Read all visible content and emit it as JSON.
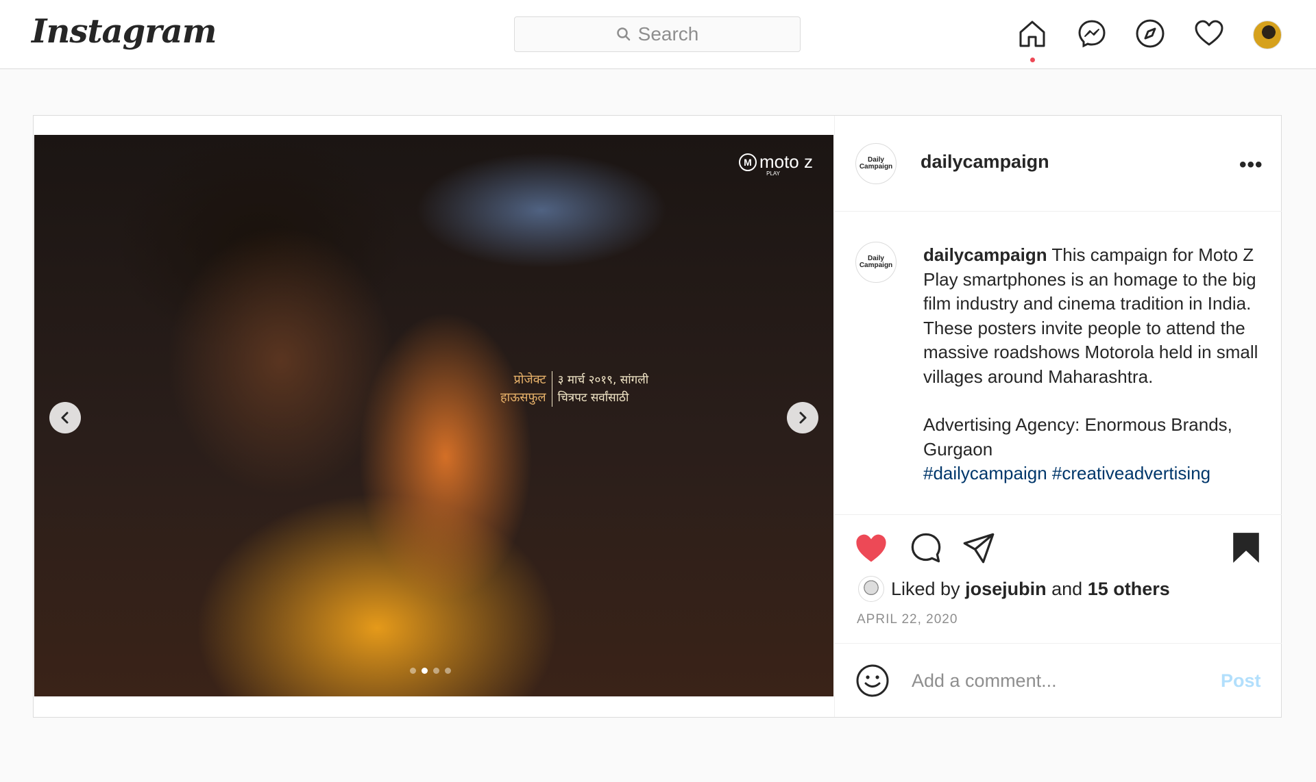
{
  "header": {
    "logo": "Instagram",
    "search_placeholder": "Search",
    "icons": [
      "home-icon",
      "messenger-icon",
      "explore-icon",
      "activity-heart-icon",
      "profile-avatar"
    ]
  },
  "post": {
    "media": {
      "brand": "moto z",
      "brand_sub": "PLAY",
      "poster_left": [
        "प्रोजेक्ट",
        "हाऊसफुल"
      ],
      "poster_right": [
        "३ मार्च २०१९, सांगली",
        "चित्रपट सर्वांसाठी"
      ],
      "carousel_dots": 4,
      "active_dot": 2
    },
    "author": {
      "username": "dailycampaign",
      "avatar_text": "Daily Campaign"
    },
    "caption": {
      "username": "dailycampaign",
      "text": "This campaign for Moto Z Play smartphones is an homage to the big film industry and cinema tradition in India. These posters invite people to attend the massive roadshows Motorola held in small villages around Maharashtra.",
      "agency": "Advertising Agency: Enormous Brands, Gurgaon",
      "hashtags": "#dailycampaign #creativeadvertising"
    },
    "likes": {
      "prefix": "Liked by",
      "user": "josejubin",
      "and": "and",
      "others": "15 others"
    },
    "date": "APRIL 22, 2020",
    "comment": {
      "placeholder": "Add a comment...",
      "post_label": "Post"
    },
    "colors": {
      "like": "#ed4956",
      "link": "#00376b",
      "post_disabled": "#b2dffc"
    }
  }
}
